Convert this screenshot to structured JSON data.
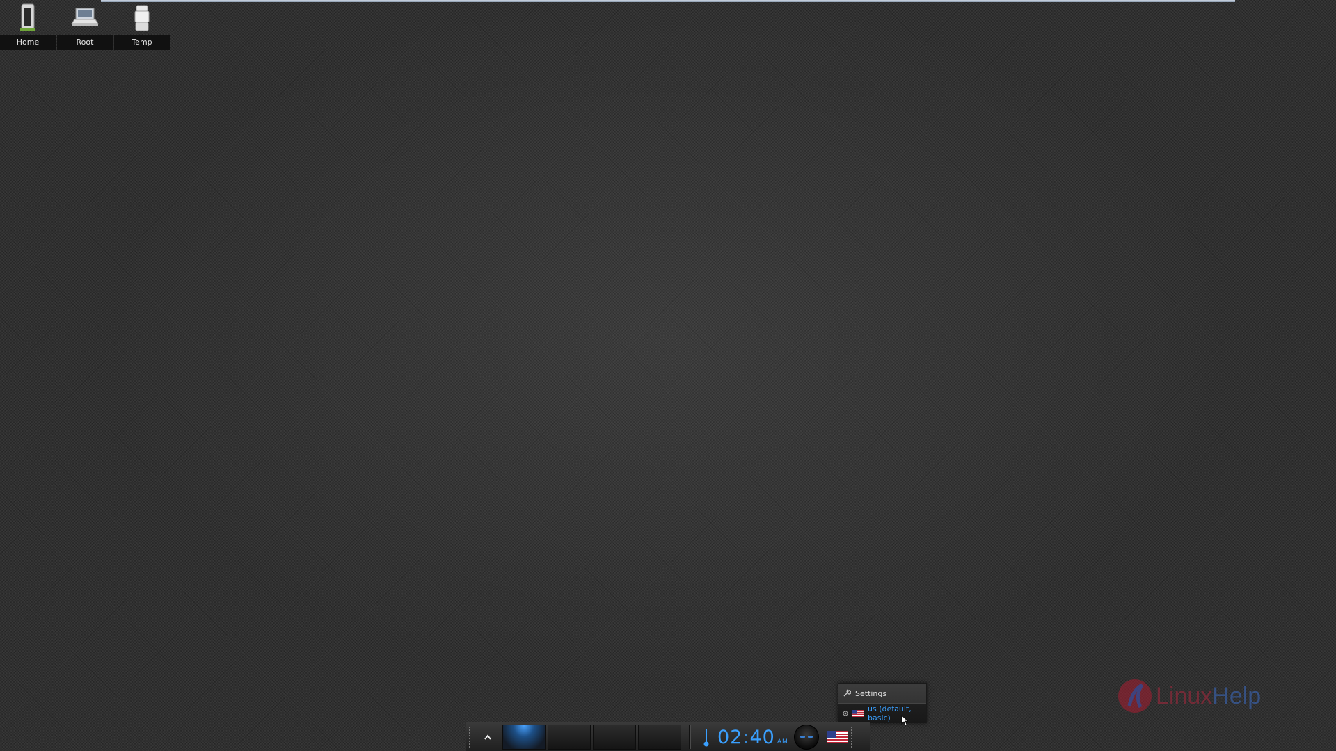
{
  "desktop": {
    "icons": [
      {
        "label": "Home",
        "icon": "folder-home-icon"
      },
      {
        "label": "Root",
        "icon": "laptop-icon"
      },
      {
        "label": "Temp",
        "icon": "trash-icon"
      }
    ]
  },
  "keyboard_menu": {
    "settings_label": "Settings",
    "layout_label": "us (default, basic)"
  },
  "shelf": {
    "clock_hours": "02",
    "clock_minutes": "40",
    "clock_ampm": "AM",
    "active_desktop": 1,
    "desktop_count": 4,
    "keyboard_flag": "us-flag-icon"
  },
  "watermark": {
    "text_a": "Linux",
    "text_b": "Help"
  },
  "colors": {
    "accent": "#3aa0ff",
    "background": "#303030"
  }
}
